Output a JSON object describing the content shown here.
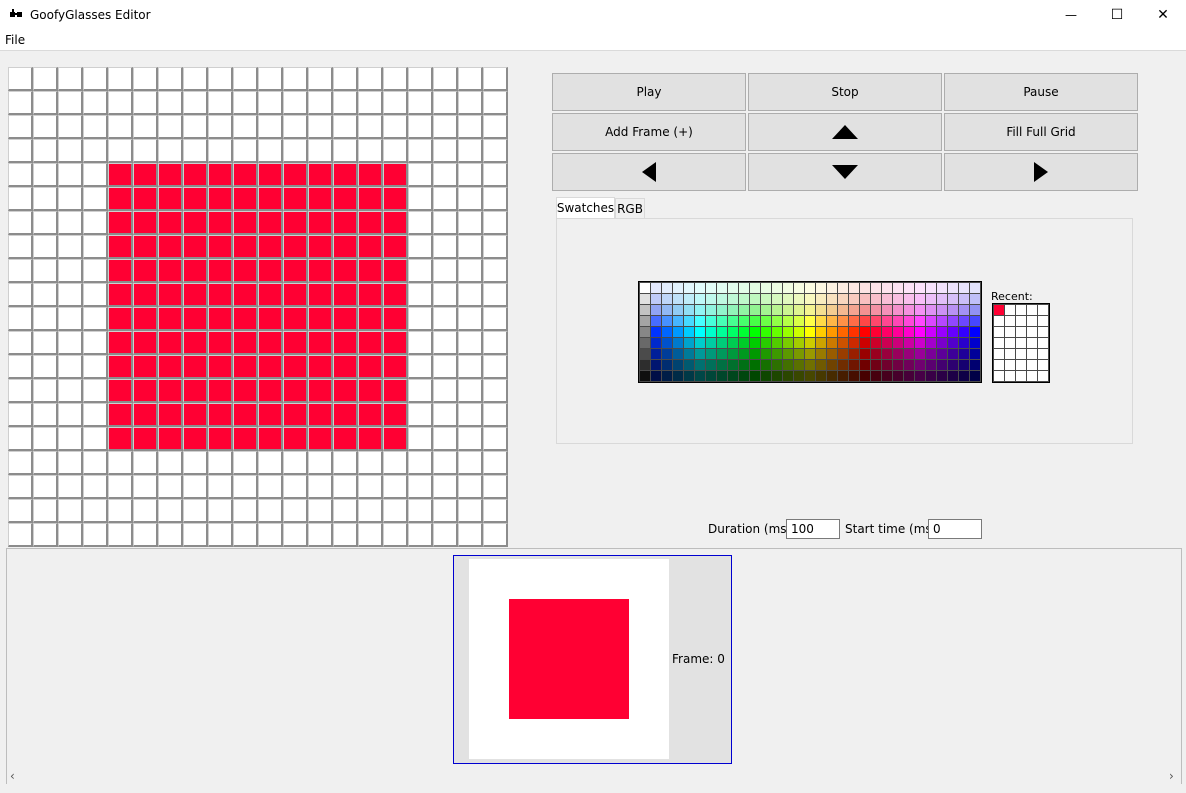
{
  "window": {
    "title": "GoofyGlasses Editor",
    "minimize_glyph": "—",
    "maximize_glyph": "☐",
    "close_glyph": "✕"
  },
  "menu": {
    "file": "File"
  },
  "colors": {
    "selected": "#ff0033",
    "grid_empty": "#ffffff"
  },
  "pixel_grid": {
    "columns": 20,
    "rows": 20,
    "filled": {
      "col_start": 4,
      "col_end": 15,
      "row_start": 4,
      "row_end": 15
    }
  },
  "controls": {
    "play": "Play",
    "stop": "Stop",
    "pause": "Pause",
    "add_frame": "Add Frame (+)",
    "fill_full_grid": "Fill Full Grid"
  },
  "tabs": {
    "swatches": "Swatches",
    "rgb": "RGB"
  },
  "swatches": {
    "recent_label": "Recent:"
  },
  "timing": {
    "duration_label": "Duration (ms):",
    "duration_value": "100",
    "start_label": "Start time (ms):",
    "start_value": "0"
  },
  "timeline": {
    "frame_label": "Frame: 0"
  }
}
